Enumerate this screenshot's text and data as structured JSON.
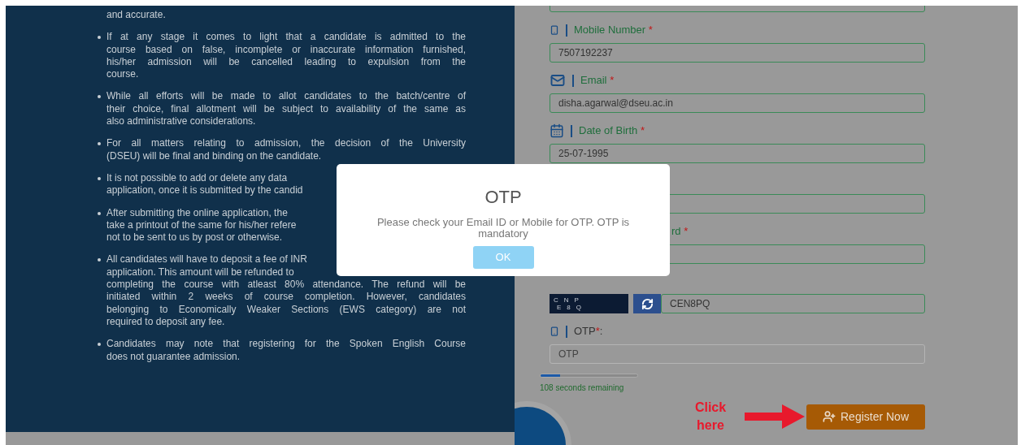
{
  "terms": [
    {
      "bullet": false,
      "lines": [
        {
          "text": "and accurate."
        }
      ]
    },
    {
      "bullet": true,
      "lines": [
        {
          "text": "If at any stage it comes to light that a candidate is admitted to the",
          "hidden_by_dialog": false
        },
        {
          "text": "course based on false, incomplete or inaccurate information furnished,",
          "hidden_by_dialog": false
        },
        {
          "text": "his/her admission will be cancelled leading to expulsion from the",
          "hidden_by_dialog": false
        },
        {
          "text": "course."
        }
      ]
    },
    {
      "bullet": true,
      "lines": [
        {
          "text": "While all efforts will be made to allot candidates to the batch/centre of",
          "hidden_by_dialog": false
        },
        {
          "text": "their choice, final allotment will be subject to availability of the same as",
          "hidden_by_dialog": false
        },
        {
          "text": "also administrative considerations."
        }
      ]
    },
    {
      "bullet": true,
      "lines": [
        {
          "text": "For all matters relating to admission, the decision of the University",
          "hidden_by_dialog": false
        },
        {
          "text": "(DSEU) will be final and binding on the candidate."
        }
      ]
    },
    {
      "bullet": true,
      "lines": [
        {
          "text": "It is not possible to add or delete any data",
          "hidden_by_dialog": true
        },
        {
          "text": "application, once it is submitted by the candid"
        }
      ]
    },
    {
      "bullet": true,
      "lines": [
        {
          "text": "After submitting the online application, the",
          "hidden_by_dialog": true
        },
        {
          "text": "take a printout of the same for his/her refere",
          "hidden_by_dialog": true
        },
        {
          "text": "not to be sent to us by post or otherwise."
        }
      ]
    },
    {
      "bullet": true,
      "lines": [
        {
          "text": "All candidates will have to deposit a fee of INR",
          "hidden_by_dialog": true
        },
        {
          "text": "application. This amount will be refunded to",
          "hidden_by_dialog": true
        },
        {
          "text": "completing the course with atleast 80% attendance. The refund will be",
          "hidden_by_dialog": false
        },
        {
          "text": "initiated within 2 weeks of course completion. However, candidates",
          "hidden_by_dialog": false
        },
        {
          "text": "belonging to Economically Weaker Sections (EWS category) are not",
          "hidden_by_dialog": false
        },
        {
          "text": "required to deposit any fee."
        }
      ]
    },
    {
      "bullet": true,
      "lines": [
        {
          "text": "Candidates may note that registering for the Spoken English Course",
          "hidden_by_dialog": false
        },
        {
          "text": "does not guarantee admission."
        }
      ]
    }
  ],
  "form": {
    "fields": [
      {
        "kind": "phone",
        "label": "Mobile Number",
        "marker": "*",
        "value": "7507192237",
        "validated": true,
        "label_hidden_by_dialog": false
      },
      {
        "kind": "email",
        "label": "Email",
        "marker": "*",
        "value": "disha.agarwal@dseu.ac.in",
        "validated": true,
        "label_hidden_by_dialog": false
      },
      {
        "kind": "date",
        "label": "Date of Birth",
        "marker": "*",
        "value": "25-07-1995",
        "validated": true,
        "label_hidden_by_dialog": false
      },
      {
        "kind": "text",
        "validated": true,
        "label_hidden_by_dialog": true
      },
      {
        "kind": "text",
        "label": "rd",
        "marker": "*",
        "validated": true,
        "label_hidden_by_dialog": true
      },
      {
        "kind": "captcha",
        "captcha_chars": [
          "C",
          "N",
          "P",
          "E",
          "8",
          "Q"
        ],
        "value": "CEN8PQ",
        "validated": true,
        "label_hidden_by_dialog": true
      },
      {
        "kind": "otp",
        "label": "OTP",
        "marker": "*",
        "suffix": ":",
        "placeholder": "OTP",
        "validated": false,
        "label_hidden_by_dialog": false
      }
    ],
    "timer": {
      "level": 0.2,
      "text": "108 seconds remaining"
    },
    "annotation": {
      "text": "Click here"
    },
    "submit": {
      "label": "Register Now"
    }
  },
  "dialog": {
    "title": "OTP",
    "message": "Please check your Email ID or Mobile for OTP. OTP is mandatory",
    "button": "OK"
  }
}
